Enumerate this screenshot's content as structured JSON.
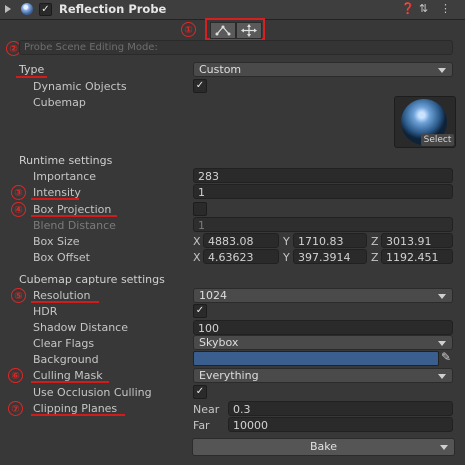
{
  "header": {
    "title": "Reflection Probe",
    "enabled": true,
    "icons": [
      "help-icon",
      "preset-icon",
      "kebab-icon"
    ]
  },
  "annotations": [
    "①",
    "②",
    "③",
    "④",
    "⑤",
    "⑥",
    "⑦"
  ],
  "scene_editing": {
    "placeholder": "Probe Scene Editing Mode:"
  },
  "type": {
    "label": "Type",
    "value": "Custom"
  },
  "dynamic_objects": {
    "label": "Dynamic Objects",
    "checked": true
  },
  "cubemap": {
    "label": "Cubemap",
    "select_label": "Select"
  },
  "runtime": {
    "section": "Runtime settings",
    "importance": {
      "label": "Importance",
      "value": "283"
    },
    "intensity": {
      "label": "Intensity",
      "value": "1"
    },
    "box_projection": {
      "label": "Box Projection",
      "checked": false
    },
    "blend_distance": {
      "label": "Blend Distance",
      "value": "1"
    },
    "box_size": {
      "label": "Box Size",
      "x": "4883.08",
      "y": "1710.83",
      "z": "3013.91"
    },
    "box_offset": {
      "label": "Box Offset",
      "x": "4.63623",
      "y": "397.3914",
      "z": "1192.451"
    }
  },
  "axis": {
    "x": "X",
    "y": "Y",
    "z": "Z"
  },
  "capture": {
    "section": "Cubemap capture settings",
    "resolution": {
      "label": "Resolution",
      "value": "1024"
    },
    "hdr": {
      "label": "HDR",
      "checked": true
    },
    "shadow_distance": {
      "label": "Shadow Distance",
      "value": "100"
    },
    "clear_flags": {
      "label": "Clear Flags",
      "value": "Skybox"
    },
    "background": {
      "label": "Background",
      "color": "#3a5f8f"
    },
    "culling_mask": {
      "label": "Culling Mask",
      "value": "Everything"
    },
    "occlusion": {
      "label": "Use Occlusion Culling",
      "checked": true
    },
    "clipping": {
      "label": "Clipping Planes",
      "near_label": "Near",
      "near": "0.3",
      "far_label": "Far",
      "far": "10000"
    }
  },
  "bake": {
    "label": "Bake"
  },
  "colors": {
    "annotation_red": "#d21b1b",
    "background": "#383838"
  }
}
